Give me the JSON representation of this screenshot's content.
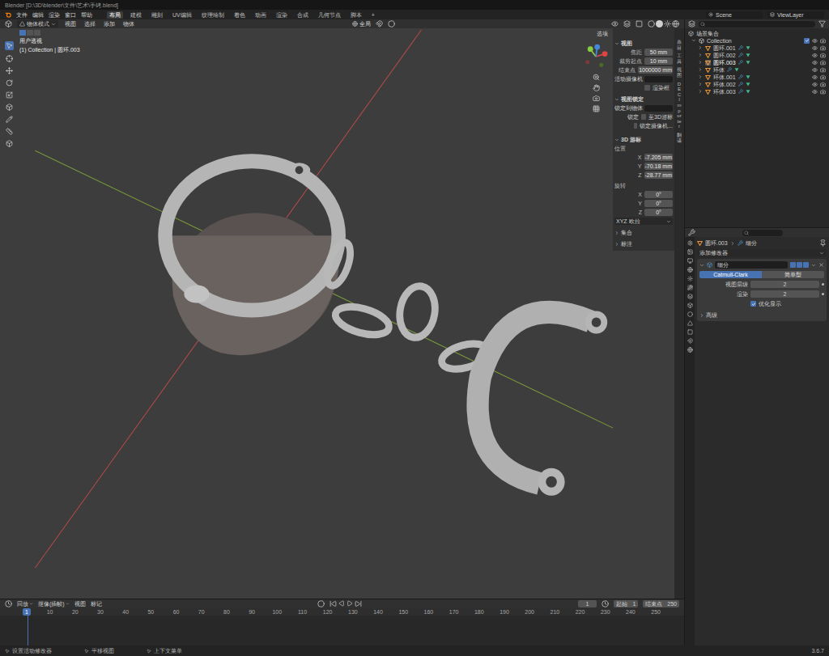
{
  "window": {
    "title": "Blender [D:\\3D\\blender\\文件\\艺术\\手铐.blend]"
  },
  "menu": [
    "文件",
    "编辑",
    "渲染",
    "窗口",
    "帮助"
  ],
  "workspaces": [
    {
      "label": "布局",
      "selected": true
    },
    {
      "label": "建模",
      "selected": false
    },
    {
      "label": "雕刻",
      "selected": false
    },
    {
      "label": "UV编辑",
      "selected": false
    },
    {
      "label": "纹理绘制",
      "selected": false
    },
    {
      "label": "着色",
      "selected": false
    },
    {
      "label": "动画",
      "selected": false
    },
    {
      "label": "渲染",
      "selected": false
    },
    {
      "label": "合成",
      "selected": false
    },
    {
      "label": "几何节点",
      "selected": false
    },
    {
      "label": "脚本",
      "selected": false
    },
    {
      "label": "+",
      "selected": false
    }
  ],
  "scene": "Scene",
  "view_layer": "ViewLayer",
  "viewport": {
    "mode": "物体模式",
    "menus": [
      "视图",
      "选择",
      "添加",
      "物体"
    ],
    "orientation": "全局",
    "options": "选项",
    "info": [
      "用户透视",
      "(1) Collection | 圆环.003"
    ]
  },
  "sidebar_tabs": [
    "条目",
    "工具",
    "视图",
    "DEC Importer",
    "翻译"
  ],
  "n_panel": {
    "view_title": "视图",
    "fields": [
      {
        "label": "焦距",
        "value": "50 mm"
      },
      {
        "label": "裁剪起点",
        "value": "10 mm"
      },
      {
        "label": "结束点",
        "value": "1000000 mm"
      }
    ],
    "active_camera": "活动摄像机",
    "render_region": {
      "label": "渲染框",
      "checked": false
    },
    "lock_title": "视图锁定",
    "lock_object": "锁定到物体",
    "lock_label": "锁定",
    "lock_options": [
      {
        "label": "至3D游标",
        "checked": false
      },
      {
        "label": "锁定摄像机...",
        "checked": false
      }
    ],
    "cursor_title": "3D 游标",
    "location_label": "位置",
    "location": [
      {
        "axis": "X",
        "value": "-7.205 mm"
      },
      {
        "axis": "Y",
        "value": "-70.18 mm"
      },
      {
        "axis": "Z",
        "value": "-28.77 mm"
      }
    ],
    "rotation_label": "旋转",
    "rotation": [
      {
        "axis": "X",
        "value": "0°"
      },
      {
        "axis": "Y",
        "value": "0°"
      },
      {
        "axis": "Z",
        "value": "0°"
      }
    ],
    "rotation_mode": "XYZ 欧拉",
    "collapsed": [
      "集合",
      "标注"
    ]
  },
  "outliner": {
    "root": "场景集合",
    "collection": "Collection",
    "items": [
      {
        "name": "圆环.001",
        "selected": false
      },
      {
        "name": "圆环.002",
        "selected": false
      },
      {
        "name": "圆环.003",
        "selected": true
      },
      {
        "name": "环体",
        "selected": false
      },
      {
        "name": "环体.001",
        "selected": false
      },
      {
        "name": "环体.002",
        "selected": false
      },
      {
        "name": "环体.003",
        "selected": false
      }
    ]
  },
  "properties": {
    "breadcrumb": [
      "圆环.003",
      "细分"
    ],
    "add_modifier": "添加修改器",
    "modifier_name": "细分",
    "types": [
      {
        "label": "Catmull-Clark",
        "selected": true
      },
      {
        "label": "简单型",
        "selected": false
      }
    ],
    "fields": [
      {
        "label": "视图层级",
        "value": "2"
      },
      {
        "label": "渲染",
        "value": "2"
      }
    ],
    "optimal": {
      "label": "优化显示",
      "checked": true
    },
    "advanced": "高级"
  },
  "timeline": {
    "menus": [
      "回放",
      "抠像(插帧)",
      "视图",
      "标记"
    ],
    "current": "1",
    "start_label": "起始",
    "start": "1",
    "end_label": "结束点",
    "end": "250",
    "ticks": [
      "10",
      "20",
      "30",
      "40",
      "50",
      "60",
      "70",
      "80",
      "90",
      "100",
      "110",
      "120",
      "130",
      "140",
      "150",
      "160",
      "170",
      "180",
      "190",
      "200",
      "210",
      "220",
      "230",
      "240",
      "250"
    ]
  },
  "status_bar": {
    "items": [
      "设置活动修改器",
      "平移视图",
      "上下文菜单"
    ],
    "version": "3.6.7"
  }
}
